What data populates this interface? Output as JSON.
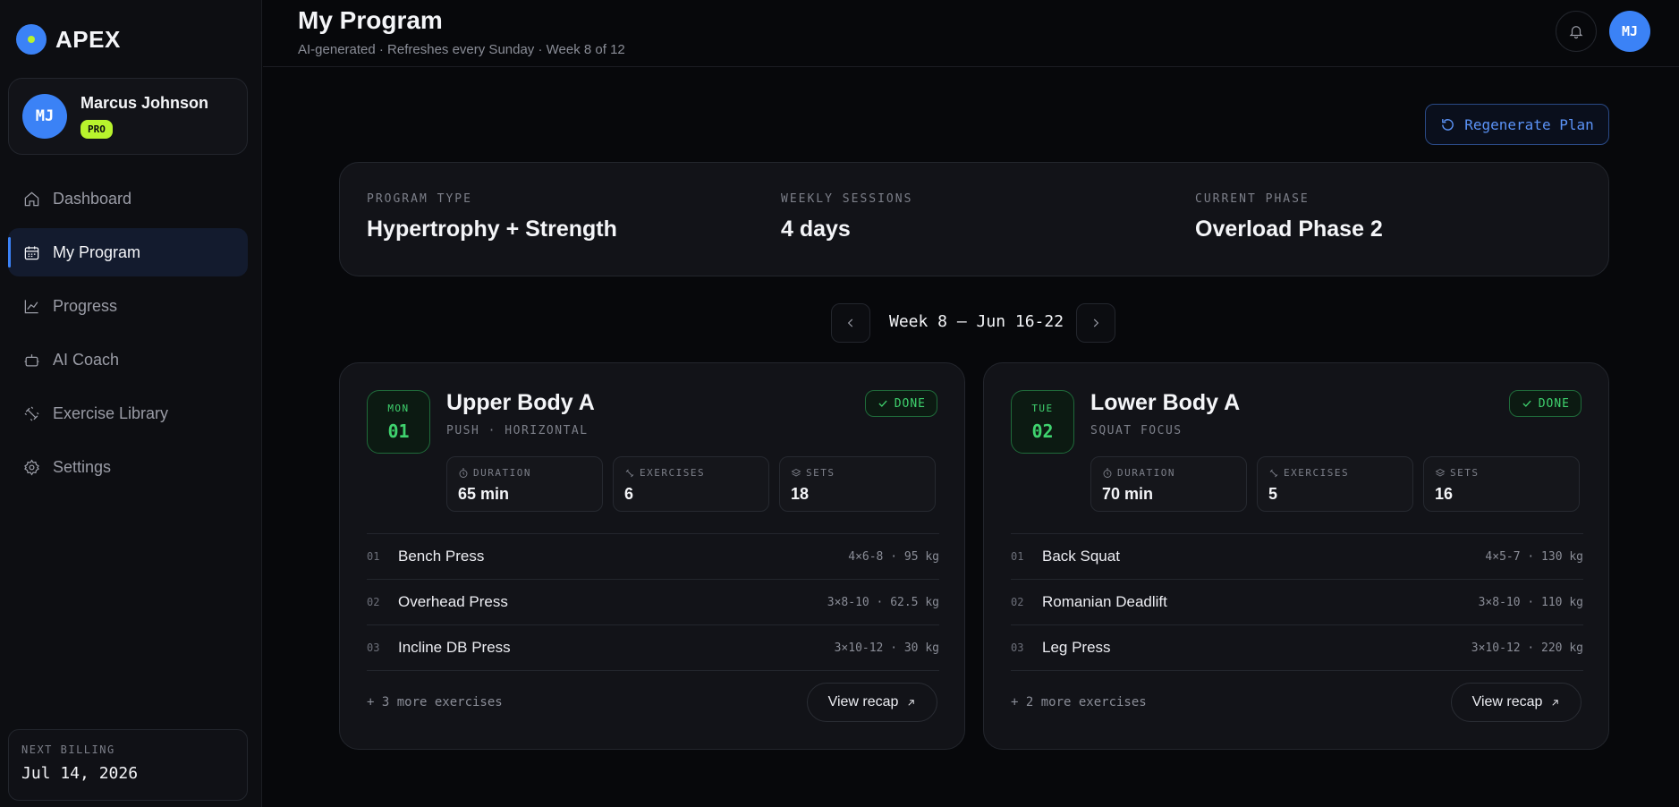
{
  "brand": {
    "name": "APEX"
  },
  "user": {
    "name": "Marcus Johnson",
    "initials": "MJ",
    "plan_badge": "PRO"
  },
  "nav": [
    {
      "label": "Dashboard",
      "icon": "home-icon"
    },
    {
      "label": "My Program",
      "icon": "calendar-icon",
      "active": true
    },
    {
      "label": "Progress",
      "icon": "chart-line-icon"
    },
    {
      "label": "AI Coach",
      "icon": "robot-icon"
    },
    {
      "label": "Exercise Library",
      "icon": "dumbbell-icon"
    },
    {
      "label": "Settings",
      "icon": "gear-icon"
    }
  ],
  "billing": {
    "label": "NEXT BILLING",
    "date": "Jul 14, 2026"
  },
  "header": {
    "title": "My Program",
    "subtitle": "AI-generated · Refreshes every Sunday · Week 8 of 12",
    "avatar_initials": "MJ"
  },
  "actions": {
    "regenerate_label": "Regenerate Plan"
  },
  "summary": {
    "program_type_label": "PROGRAM TYPE",
    "program_type": "Hypertrophy + Strength",
    "weekly_sessions_label": "WEEKLY SESSIONS",
    "weekly_sessions": "4 days",
    "current_phase_label": "CURRENT PHASE",
    "current_phase": "Overload Phase 2"
  },
  "week": {
    "label": "Week 8 — Jun 16-22"
  },
  "days": [
    {
      "dow": "MON",
      "num": "01",
      "title": "Upper Body A",
      "subtitle": "PUSH · HORIZONTAL",
      "status": "DONE",
      "stats": {
        "duration_label": "DURATION",
        "duration": "65 min",
        "exercises_label": "EXERCISES",
        "exercises": "6",
        "sets_label": "SETS",
        "sets": "18"
      },
      "exercises": [
        {
          "num": "01",
          "name": "Bench Press",
          "detail": "4×6-8 · 95 kg"
        },
        {
          "num": "02",
          "name": "Overhead Press",
          "detail": "3×8-10 · 62.5 kg"
        },
        {
          "num": "03",
          "name": "Incline DB Press",
          "detail": "3×10-12 · 30 kg"
        }
      ],
      "more": "+ 3 more exercises",
      "recap_label": "View recap"
    },
    {
      "dow": "TUE",
      "num": "02",
      "title": "Lower Body A",
      "subtitle": "SQUAT FOCUS",
      "status": "DONE",
      "stats": {
        "duration_label": "DURATION",
        "duration": "70 min",
        "exercises_label": "EXERCISES",
        "exercises": "5",
        "sets_label": "SETS",
        "sets": "16"
      },
      "exercises": [
        {
          "num": "01",
          "name": "Back Squat",
          "detail": "4×5-7 · 130 kg"
        },
        {
          "num": "02",
          "name": "Romanian Deadlift",
          "detail": "3×8-10 · 110 kg"
        },
        {
          "num": "03",
          "name": "Leg Press",
          "detail": "3×10-12 · 220 kg"
        }
      ],
      "more": "+ 2 more exercises",
      "recap_label": "View recap"
    }
  ],
  "colors": {
    "accent_blue": "#3b82f6",
    "accent_lime": "#b8f32d",
    "success_green": "#3fd26e",
    "background": "#07080b"
  }
}
